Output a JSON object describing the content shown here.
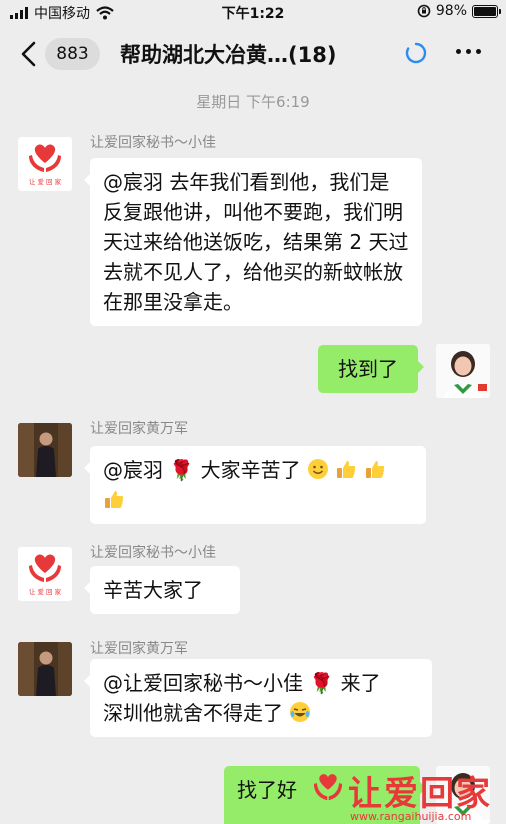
{
  "status_bar": {
    "carrier": "中国移动",
    "time": "下午1:22",
    "battery": "98%",
    "battery_level": 0.98
  },
  "nav": {
    "unread_count": "883",
    "title": "帮助湖北大冶黄…(18)"
  },
  "time_separator": "星期日 下午6:19",
  "messages": [
    {
      "sender": "让爱回家秘书～小佳",
      "text": "@宸羽 去年我们看到他，我们是反复跟他讲，叫他不要跑，我们明天过来给他送饭吃，结果第 2 天过去就不见人了，给他买的新蚊帐放在那里没拿走。"
    },
    {
      "text": "找到了"
    },
    {
      "sender": "让爱回家黄万军",
      "text": "@宸羽 🌹 大家辛苦了",
      "emojis": [
        "smile-emoji",
        "thumbs-up-emoji",
        "thumbs-up-emoji",
        "thumbs-up-emoji"
      ]
    },
    {
      "sender": "让爱回家秘书～小佳",
      "text": "辛苦大家了"
    },
    {
      "sender": "让爱回家黄万军",
      "text_line1": "@让爱回家秘书～小佳 🌹 来了",
      "text_line2": "深圳他就舍不得走了",
      "emojis": [
        "laugh-cry-emoji"
      ]
    },
    {
      "text": "找了好"
    }
  ],
  "logo_text": "让 爱 回 家",
  "watermark": {
    "title": "让爱回家",
    "url": "www.rangaihuijia.com"
  },
  "colors": {
    "background": "#ededed",
    "outgoing_bubble": "#95ec69",
    "incoming_bubble": "#ffffff",
    "logo_red": "#e8393a"
  }
}
